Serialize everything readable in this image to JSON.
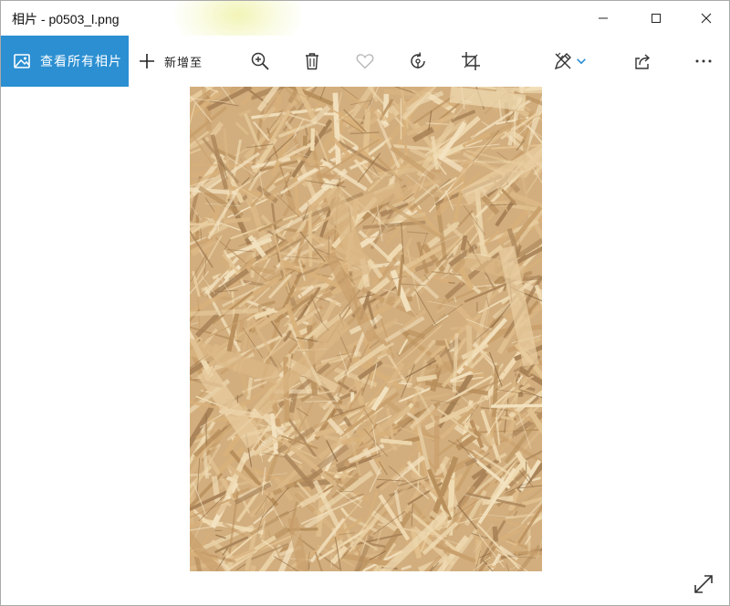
{
  "window": {
    "title": "相片 - p0503_l.png"
  },
  "toolbar": {
    "view_all_label": "查看所有相片",
    "add_to_label": "新增至"
  },
  "photo": {
    "filename": "p0503_l.png",
    "texture": "wood-chip-board"
  },
  "colors": {
    "accent": "#2b8fd2",
    "wood_base": "#d2ae7e",
    "wood_light": "#e8cc9d",
    "wood_dark": "#9c7649",
    "icon": "#333333",
    "icon_disabled": "#b8b8b8"
  },
  "icons": [
    "photos-icon",
    "plus-icon",
    "zoom-in-icon",
    "trash-icon",
    "heart-icon",
    "rotate-icon",
    "crop-icon",
    "edit-icon",
    "chevron-down-icon",
    "share-icon",
    "more-icon",
    "minimize-icon",
    "maximize-icon",
    "close-icon",
    "expand-icon"
  ]
}
